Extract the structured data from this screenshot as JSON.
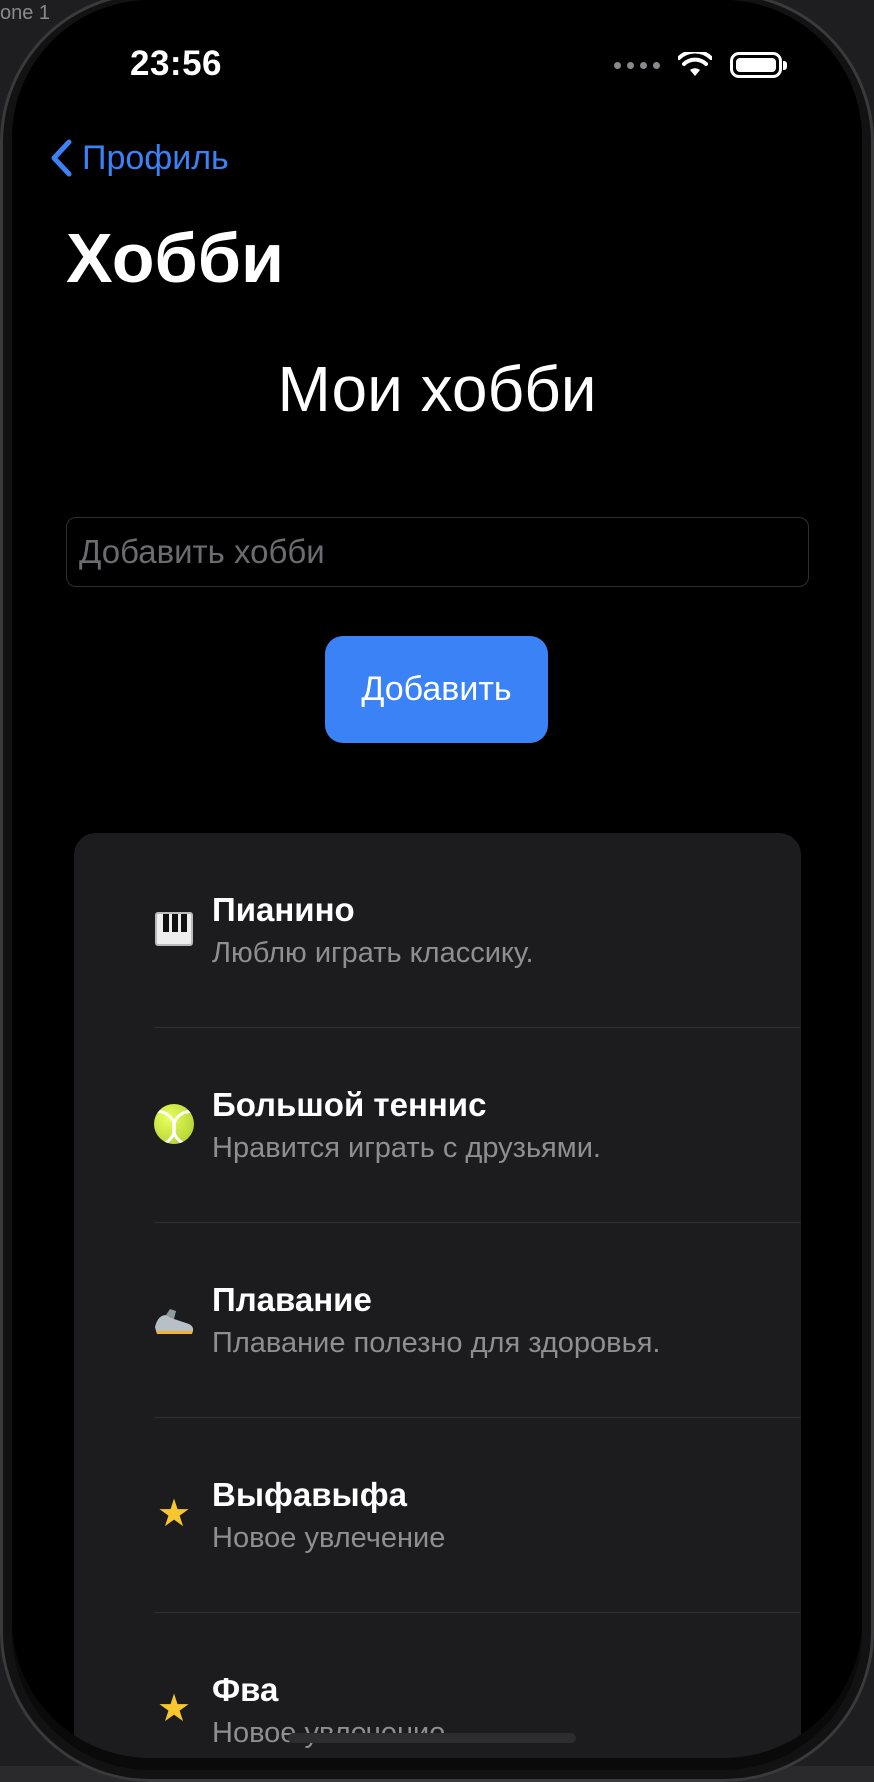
{
  "status_bar": {
    "time": "23:56"
  },
  "simulator": {
    "tab_text": "one 1"
  },
  "nav": {
    "back_label": "Профиль",
    "large_title": "Хобби"
  },
  "main": {
    "heading": "Мои хобби",
    "input_placeholder": "Добавить хобби",
    "input_value": "",
    "add_button_label": "Добавить"
  },
  "hobbies": [
    {
      "icon": "piano-icon",
      "title": "Пианино",
      "subtitle": "Люблю играть классику."
    },
    {
      "icon": "tennis-ball-icon",
      "title": "Большой теннис",
      "subtitle": "Нравится играть с друзьями."
    },
    {
      "icon": "running-shoe-icon",
      "title": "Плавание",
      "subtitle": "Плавание полезно для здоровья."
    },
    {
      "icon": "star-icon",
      "title": "Выфавыфа",
      "subtitle": "Новое увлечение"
    },
    {
      "icon": "star-icon",
      "title": "Фва",
      "subtitle": "Новое увлечение"
    }
  ],
  "colors": {
    "accent": "#3b82f6",
    "background": "#000000",
    "card": "#1c1c1e",
    "secondary_text": "#8e8e93"
  }
}
